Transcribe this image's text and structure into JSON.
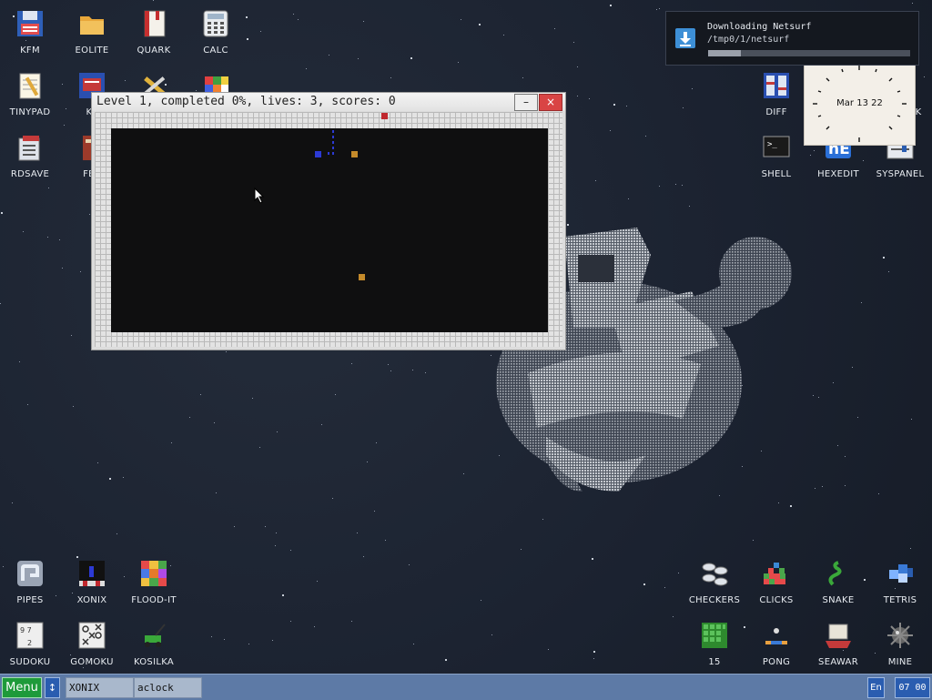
{
  "desktop": {
    "icons_left": [
      {
        "label": "KFM",
        "icon": "floppy-disk-icon"
      },
      {
        "label": "EOLITE",
        "icon": "folder-icon"
      },
      {
        "label": "QUARK",
        "icon": "book-icon"
      },
      {
        "label": "CALC",
        "icon": "calculator-icon"
      },
      {
        "label": "TINYPAD",
        "icon": "notepad-icon"
      },
      {
        "label": "KF",
        "icon": "kf-editor-icon"
      },
      {
        "label": "RDSAVE",
        "icon": "rdsave-icon"
      },
      {
        "label": "FB2",
        "icon": "fb2-reader-icon"
      }
    ],
    "icons_right": [
      {
        "label": "DIFF",
        "icon": "diff-icon"
      },
      {
        "label": "K",
        "icon": "app-icon"
      },
      {
        "label": "SHELL",
        "icon": "terminal-icon"
      },
      {
        "label": "HEXEDIT",
        "icon": "hexedit-icon"
      },
      {
        "label": "SYSPANEL",
        "icon": "syspanel-icon"
      }
    ],
    "icons_bottom_left": [
      {
        "label": "PIPES",
        "icon": "pipes-icon"
      },
      {
        "label": "XONIX",
        "icon": "xonix-icon"
      },
      {
        "label": "FLOOD-IT",
        "icon": "flood-it-icon"
      },
      {
        "label": "SUDOKU",
        "icon": "sudoku-icon"
      },
      {
        "label": "GOMOKU",
        "icon": "gomoku-icon"
      },
      {
        "label": "KOSILKA",
        "icon": "lawnmower-icon"
      }
    ],
    "icons_bottom_right": [
      {
        "label": "CHECKERS",
        "icon": "checkers-icon"
      },
      {
        "label": "CLICKS",
        "icon": "clicks-icon"
      },
      {
        "label": "SNAKE",
        "icon": "snake-icon"
      },
      {
        "label": "TETRIS",
        "icon": "tetris-icon"
      },
      {
        "label": "15",
        "icon": "fifteen-puzzle-icon"
      },
      {
        "label": "PONG",
        "icon": "pong-icon"
      },
      {
        "label": "SEAWAR",
        "icon": "seawar-icon"
      },
      {
        "label": "MINE",
        "icon": "mine-icon"
      }
    ]
  },
  "notification": {
    "title": "Downloading Netsurf",
    "path": "/tmp0/1/netsurf",
    "progress": 0.16
  },
  "clock": {
    "date": "Mar 13 22"
  },
  "game_window": {
    "title": "Level 1, completed 0%, lives: 3, scores: 0",
    "minimize": "–",
    "close": "×"
  },
  "taskbar": {
    "menu": "Menu",
    "switch": "↕",
    "tasks": [
      "XONIX",
      "aclock"
    ],
    "lang": "En",
    "time": "07 00"
  },
  "colors": {
    "accent": "#2a5db0",
    "menu_green": "#1e9a3a",
    "enemy": "#c48a2a",
    "player": "#2c3ad4",
    "land_enemy": "#c0282e"
  }
}
